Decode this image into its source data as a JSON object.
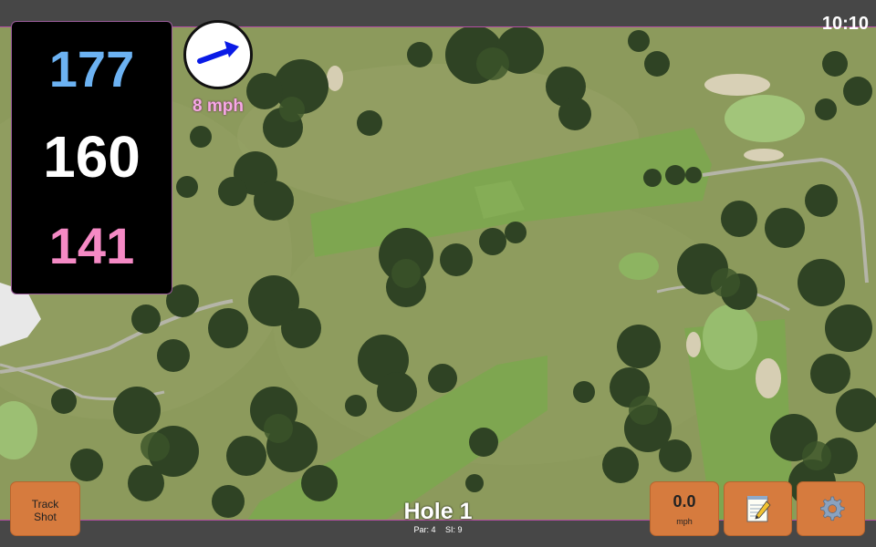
{
  "status": {
    "time": "10:10"
  },
  "distances": {
    "back": "177",
    "middle": "160",
    "front": "141"
  },
  "wind": {
    "speed_label": "8 mph"
  },
  "hole": {
    "title": "Hole 1",
    "par": "Par: 4",
    "stroke_index": "SI: 9"
  },
  "buttons": {
    "track_line1": "Track",
    "track_line2": "Shot",
    "speed_value": "0.0",
    "speed_unit": "mph",
    "notes_icon": "notepad-icon",
    "settings_icon": "gear-icon"
  },
  "colors": {
    "back": "#6cb2f2",
    "middle": "#ffffff",
    "front": "#f58ac5",
    "button": "#d67b3e",
    "wind_arrow": "#0a1be6"
  }
}
